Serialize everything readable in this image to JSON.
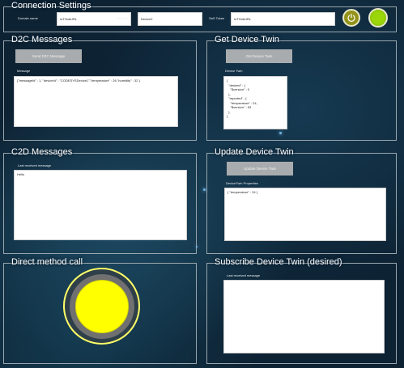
{
  "connection": {
    "title": "Connection Settings",
    "domain_label": "Domain name",
    "domain_value": "IoTHubURL",
    "device_label": "Device id",
    "device_value": "Device2",
    "sas_label": "SaS Token",
    "sas_value": "IoTHubURL",
    "power_icon": "power-icon",
    "status_color": "#9ad60a"
  },
  "d2c": {
    "title": "D2C Messages",
    "send_button": "Send D2C Message",
    "message_label": "Message",
    "message_value": "{\"messageId\" : 1, \"deviceId\" : \"CODESYSDevice1\",\"temperature\" : 26,\"humidity\" : 32 }"
  },
  "twin": {
    "title": "Get Device Twin",
    "get_button": "Get Device Twin",
    "twin_label": "Device Twin",
    "twin_value": "{\n  \"desired\" : {\n    \"$version\" : 0\n  },\n  \"reported\" : {\n    \"temperature\" : 24,\n    \"$version\" : 53\n  }\n}"
  },
  "c2d": {
    "title": "C2D Messages",
    "last_label": "Last received message",
    "last_value": "Hello"
  },
  "update_twin": {
    "title": "Update Device Twin",
    "update_button": "Update Device Twin",
    "props_label": "DeviceTwin Properties",
    "props_value": "{ \"temperature\" : 24 }"
  },
  "direct": {
    "title": "Direct method call",
    "lamp_color": "#ffff00"
  },
  "subscribe": {
    "title": "Subscribe Device Twin (desired)",
    "last_label": "Last received message",
    "last_value": ""
  }
}
